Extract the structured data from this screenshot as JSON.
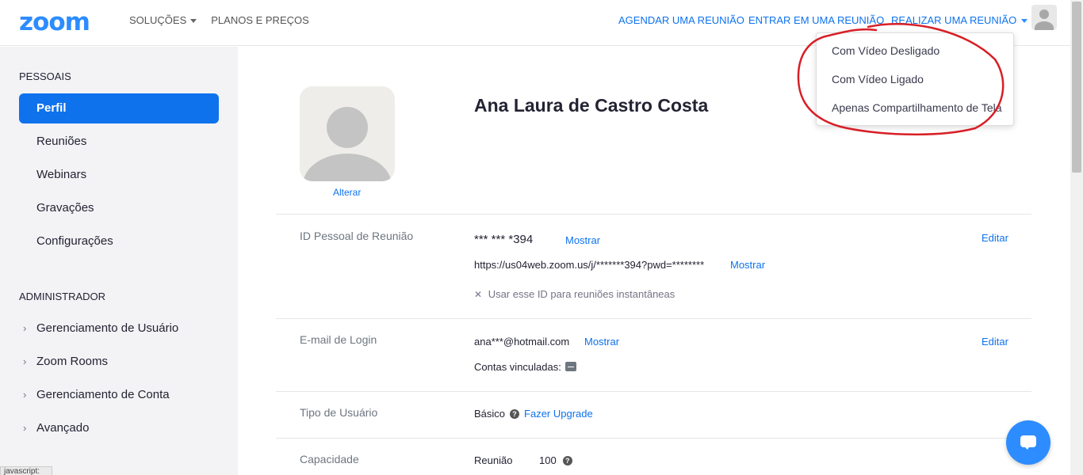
{
  "header": {
    "logo": "zoom",
    "nav_left": [
      "SOLUÇÕES",
      "PLANOS E PREÇOS"
    ],
    "schedule": "AGENDAR UMA REUNIÃO",
    "join": "ENTRAR EM UMA REUNIÃO",
    "host": "REALIZAR UMA REUNIÃO"
  },
  "dropdown": {
    "items": [
      "Com Vídeo Desligado",
      "Com Vídeo Ligado",
      "Apenas Compartilhamento de Tela"
    ],
    "annotation_color": "#d81f26"
  },
  "sidebar": {
    "personal_title": "PESSOAIS",
    "personal_items": [
      "Perfil",
      "Reuniões",
      "Webinars",
      "Gravações",
      "Configurações"
    ],
    "admin_title": "ADMINISTRADOR",
    "admin_items": [
      "Gerenciamento de Usuário",
      "Zoom Rooms",
      "Gerenciamento de Conta",
      "Avançado"
    ],
    "status_tag": "javascript:"
  },
  "profile": {
    "change_photo": "Alterar",
    "name": "Ana Laura de Castro Costa",
    "pmi": {
      "label": "ID Pessoal de Reunião",
      "value": "*** *** *394",
      "show": "Mostrar",
      "url": "https://us04web.zoom.us/j/*******394?pwd=********",
      "url_show": "Mostrar",
      "instant_text": "Usar esse ID para reuniões instantâneas",
      "edit": "Editar"
    },
    "email": {
      "label": "E-mail de Login",
      "value": "ana***@hotmail.com",
      "show": "Mostrar",
      "linked": "Contas vinculadas:",
      "edit": "Editar"
    },
    "user_type": {
      "label": "Tipo de Usuário",
      "value": "Básico",
      "upgrade": "Fazer Upgrade"
    },
    "capacity": {
      "label": "Capacidade",
      "meeting_label": "Reunião",
      "meeting_value": "100"
    }
  },
  "colors": {
    "brand": "#2d8cff",
    "link": "#0e72ed",
    "sidebar_bg": "#f3f3f6"
  }
}
